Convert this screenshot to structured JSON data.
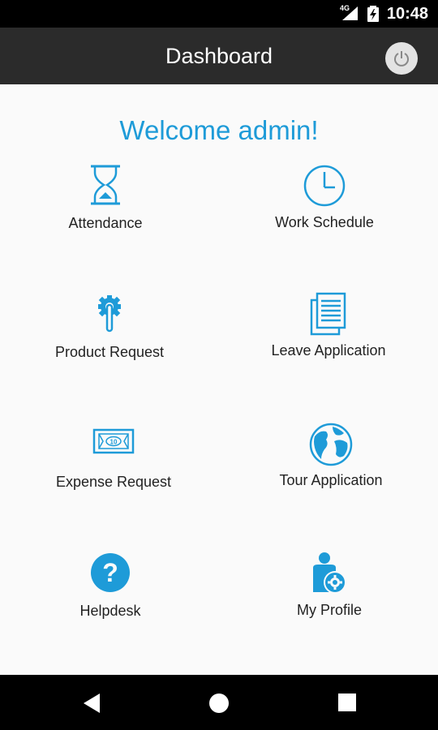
{
  "status_bar": {
    "network": "4G",
    "time": "10:48",
    "icons": [
      "signal-icon",
      "battery-charging-icon"
    ]
  },
  "app_bar": {
    "title": "Dashboard",
    "power_icon": "power-icon"
  },
  "welcome": "Welcome admin!",
  "accent_color": "#1e9bd8",
  "tiles": [
    {
      "label": "Attendance",
      "icon": "hourglass-icon"
    },
    {
      "label": "Work Schedule",
      "icon": "clock-icon"
    },
    {
      "label": "Product Request",
      "icon": "wrench-gear-icon"
    },
    {
      "label": "Leave Application",
      "icon": "documents-icon"
    },
    {
      "label": "Expense Request",
      "icon": "banknote-icon"
    },
    {
      "label": "Tour Application",
      "icon": "globe-icon"
    },
    {
      "label": "Helpdesk",
      "icon": "help-icon"
    },
    {
      "label": "My Profile",
      "icon": "profile-settings-icon"
    }
  ],
  "nav_bar": {
    "icons": [
      "back-icon",
      "home-icon",
      "recents-icon"
    ]
  }
}
